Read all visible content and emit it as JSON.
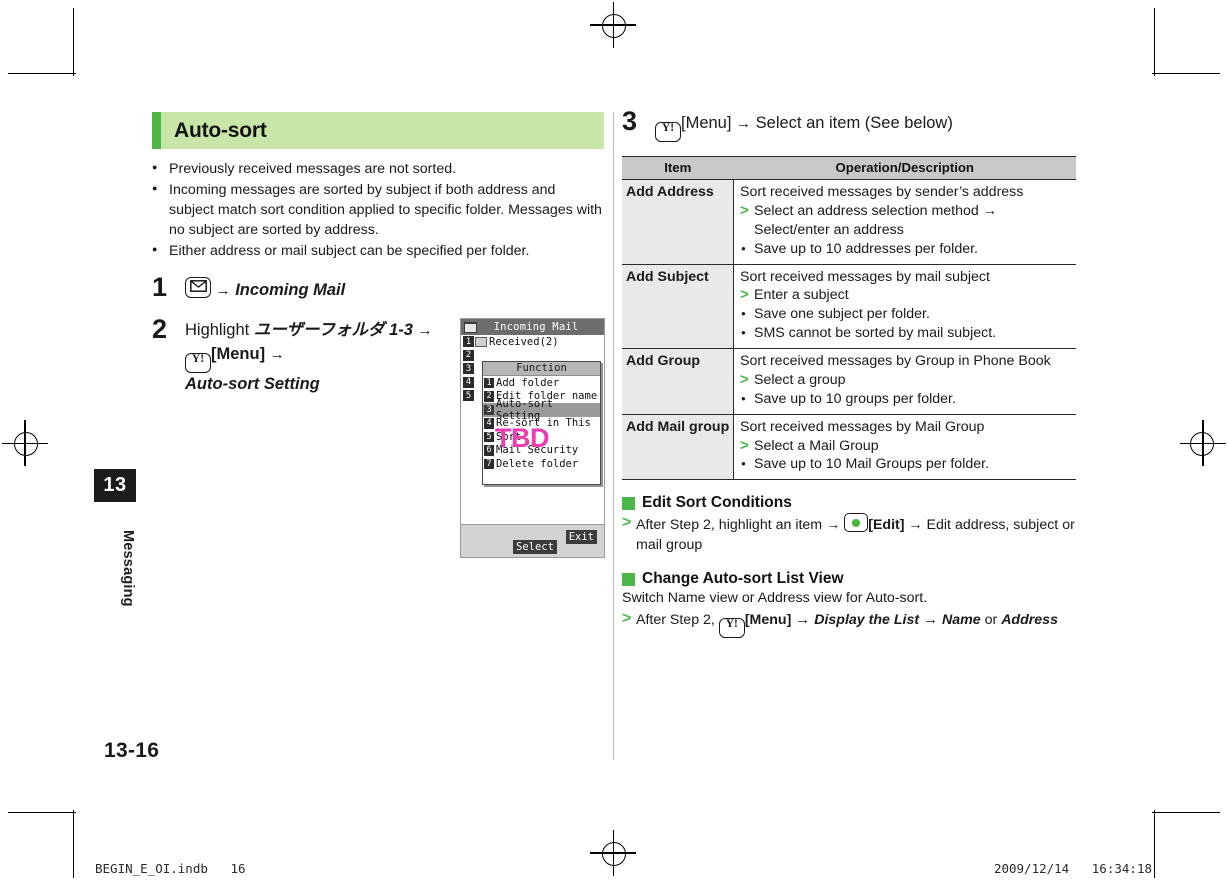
{
  "chapter": {
    "number": "13",
    "name": "Messaging",
    "page_number": "13-16"
  },
  "left": {
    "section_title": "Auto-sort",
    "bullets": [
      "Previously received messages are not sorted.",
      "Incoming messages are sorted by subject if both address and subject match sort condition applied to specific folder. Messages with no subject are sorted by address.",
      "Either address or mail subject can be specified per folder."
    ],
    "steps": [
      {
        "num": "1",
        "key_icon": "mail-key-icon",
        "arrow": "→",
        "target": "Incoming Mail"
      },
      {
        "num": "2",
        "lead": "Highlight",
        "folder": "ユーザーフォルダ 1-3",
        "arrow": "→",
        "key_icon": "yj-key-icon",
        "menu_label": "[Menu]",
        "arrow2": "→",
        "setting": "Auto-sort Setting"
      }
    ]
  },
  "phone": {
    "title": "Incoming Mail",
    "title_icon": "mail-folder-icon",
    "list": [
      {
        "index": "1",
        "label": "Received(2)",
        "has_folder_icon": true
      },
      {
        "index": "2",
        "label": "",
        "has_folder_icon": false
      },
      {
        "index": "3",
        "label": "",
        "has_folder_icon": false
      },
      {
        "index": "4",
        "label": "",
        "has_folder_icon": false
      },
      {
        "index": "5",
        "label": "",
        "has_folder_icon": false
      }
    ],
    "popup": {
      "title": "Function",
      "items": [
        {
          "index": "1",
          "label": "Add folder",
          "selected": false
        },
        {
          "index": "2",
          "label": "Edit folder name",
          "selected": false
        },
        {
          "index": "3",
          "label": "Auto-sort Setting",
          "selected": true
        },
        {
          "index": "4",
          "label": "Re-sort in This",
          "selected": false
        },
        {
          "index": "5",
          "label": "Sort",
          "selected": false
        },
        {
          "index": "6",
          "label": "Mail Security",
          "selected": false
        },
        {
          "index": "7",
          "label": "Delete folder",
          "selected": false
        }
      ]
    },
    "watermark": "TBD",
    "softkeys": {
      "select": "Select",
      "exit": "Exit"
    }
  },
  "right": {
    "step3": {
      "num": "3",
      "key_icon": "yj-key-icon",
      "menu_label": "[Menu]",
      "arrow": "→",
      "text": "Select an item (See below)"
    },
    "table": {
      "headers": {
        "item": "Item",
        "desc": "Operation/Description"
      },
      "rows": [
        {
          "item": "Add Address",
          "lines": [
            {
              "type": "plain",
              "text": "Sort received messages by sender’s address"
            },
            {
              "type": "gt",
              "text": "Select an address selection method →"
            },
            {
              "type": "cont",
              "text": "Select/enter an address"
            },
            {
              "type": "dot",
              "text": "Save up to 10 addresses per folder."
            }
          ]
        },
        {
          "item": "Add Subject",
          "lines": [
            {
              "type": "plain",
              "text": "Sort received messages by mail subject"
            },
            {
              "type": "gt",
              "text": "Enter a subject"
            },
            {
              "type": "dot",
              "text": "Save one subject per folder."
            },
            {
              "type": "dot",
              "text": "SMS cannot be sorted by mail subject."
            }
          ]
        },
        {
          "item": "Add Group",
          "lines": [
            {
              "type": "plain",
              "text": "Sort received messages by Group in Phone Book"
            },
            {
              "type": "gt",
              "text": "Select a group"
            },
            {
              "type": "dot",
              "text": "Save up to 10 groups per folder."
            }
          ]
        },
        {
          "item": "Add Mail group",
          "lines": [
            {
              "type": "plain",
              "text": "Sort received messages by Mail Group"
            },
            {
              "type": "gt",
              "text": "Select a Mail Group"
            },
            {
              "type": "dot",
              "text": "Save up to 10 Mail Groups per folder."
            }
          ]
        }
      ]
    },
    "sub_sections": [
      {
        "heading": "Edit Sort Conditions",
        "gt_pre": "After Step 2,  highlight an item →",
        "key_icon": "center-key-icon",
        "edit_label": "[Edit]",
        "gt_post": "→ Edit address, subject or mail group"
      },
      {
        "heading": "Change Auto-sort List View",
        "text": "Switch Name view or Address view for Auto-sort.",
        "gt_pre": "After Step 2,",
        "key_icon": "yj-key-icon",
        "menu_label": "[Menu]",
        "arrow": "→",
        "display_label": "Display the List",
        "arrow2": "→",
        "opt1": "Name",
        "or": "or",
        "opt2": "Address"
      }
    ]
  },
  "slug": {
    "left": "BEGIN_E_OI.indb   16",
    "right": "2009/12/14   16:34:18"
  },
  "colors": {
    "accent_green": "#4cb648",
    "head_band": "#c8e6a8",
    "table_head": "#c9c9c9",
    "item_cell": "#e9e9e9",
    "watermark": "#ef3bb0"
  }
}
